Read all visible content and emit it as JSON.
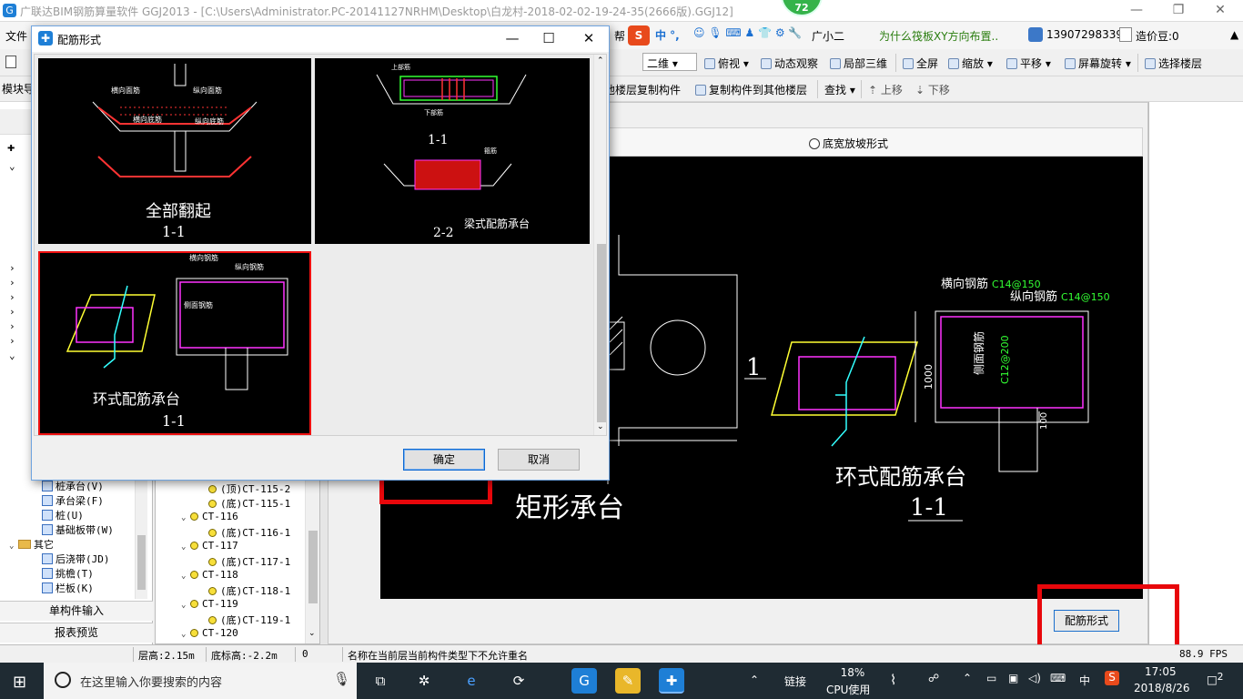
{
  "window": {
    "title": "广联达BIM钢筋算量软件 GGJ2013 - [C:\\Users\\Administrator.PC-20141127NRHM\\Desktop\\白龙村-2018-02-02-19-24-35(2666版).GGJ12]",
    "notification_count": "72",
    "minimize_label": "—",
    "restore_label": "❐",
    "close_label": "✕"
  },
  "menu": {
    "file": "文件",
    "help_truncated": "帮",
    "assistant": "广小二",
    "tip_link": "为什么筏板XY方向布置..",
    "phone": "13907298339",
    "beans": "造价豆:0"
  },
  "toolbar1": {
    "view_mode": "二维",
    "top_view": "俯视",
    "dynamic_view": "动态观察",
    "local_3d": "局部三维",
    "fullscreen": "全屏",
    "zoom": "缩放",
    "pan": "平移",
    "screen_rotate": "屏幕旋转",
    "select_floor": "选择楼层"
  },
  "toolbar2": {
    "module_nav": "模块导",
    "copy_from_other": "他楼层复制构件",
    "copy_to_other": "复制构件到其他楼层",
    "find": "查找",
    "move_up": "上移",
    "move_down": "下移"
  },
  "leftpanel": {
    "items": [
      {
        "label": "桩承台(V)"
      },
      {
        "label": "承台梁(F)"
      },
      {
        "label": "桩(U)"
      },
      {
        "label": "基础板带(W)"
      },
      {
        "label": "其它"
      },
      {
        "label": "后浇带(JD)"
      },
      {
        "label": "挑檐(T)"
      },
      {
        "label": "栏板(K)"
      }
    ],
    "single_input": "单构件输入",
    "report_preview": "报表预览"
  },
  "tree": {
    "rows": [
      {
        "label": "(顶)CT-115-2"
      },
      {
        "label": "(底)CT-115-1"
      },
      {
        "label": "CT-116"
      },
      {
        "label": "(底)CT-116-1"
      },
      {
        "label": "CT-117"
      },
      {
        "label": "(底)CT-117-1"
      },
      {
        "label": "CT-118"
      },
      {
        "label": "(底)CT-118-1"
      },
      {
        "label": "CT-119"
      },
      {
        "label": "(底)CT-119-1"
      },
      {
        "label": "CT-120"
      }
    ]
  },
  "main": {
    "radio_option": "底宽放坡形式",
    "cad_title": "矩形承台",
    "cad_section_mark": "1",
    "ring_title": "环式配筋承台",
    "ring_section": "1-1",
    "transverse_label": "横向钢筋",
    "transverse_value": "C14@150",
    "longitudinal_label": "纵向钢筋",
    "longitudinal_value": "C14@150",
    "side_label": "侧面钢筋",
    "side_value": "C12@200",
    "height_dim": "1000",
    "bottom_dim": "100",
    "peijin_button": "配筋形式"
  },
  "dialog": {
    "title": "配筋形式",
    "ok": "确定",
    "cancel": "取消",
    "thumbs": [
      {
        "caption": "全部翻起",
        "section": "1-1",
        "labels": [
          "横向面筋",
          "纵向面筋",
          "横向底筋",
          "纵向底筋"
        ]
      },
      {
        "caption": "梁式配筋承台",
        "section1": "1-1",
        "section2": "2-2",
        "labels": [
          "上部筋",
          "下部筋",
          "箍筋"
        ]
      },
      {
        "caption": "环式配筋承台",
        "section": "1-1",
        "labels": [
          "横向钢筋",
          "纵向钢筋",
          "侧面钢筋"
        ]
      }
    ]
  },
  "status": {
    "floor_height": "层高:2.15m",
    "bottom_elev": "底标高:-2.2m",
    "zero": "0",
    "message": "名称在当前层当前构件类型下不允许重名",
    "fps": "88.9 FPS"
  },
  "taskbar": {
    "search_placeholder": "在这里输入你要搜索的内容",
    "link": "链接",
    "cpu_value": "18%",
    "cpu_label": "CPU使用",
    "ime": "中",
    "time": "17:05",
    "date": "2018/8/26",
    "notif": "2"
  },
  "colors": {
    "highlight": "#e8070b",
    "accent": "#1e7fd6",
    "cad_bg": "#000000"
  }
}
